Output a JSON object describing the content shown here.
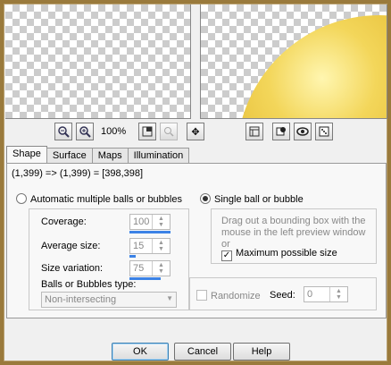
{
  "toolbar": {
    "zoom": "100%",
    "icons": [
      "zoom-out-icon",
      "zoom-in-icon",
      "fit-window-icon",
      "zoom-proof-icon",
      "pan-icon",
      "preview-toggle-icon",
      "randomize-icon",
      "eye-icon",
      "dice-icon"
    ]
  },
  "tabs": [
    {
      "label": "Shape",
      "active": true
    },
    {
      "label": "Surface",
      "active": false
    },
    {
      "label": "Maps",
      "active": false
    },
    {
      "label": "Illumination",
      "active": false
    }
  ],
  "shape": {
    "coords": "(1,399) => (1,399) = [398,398]",
    "auto_option": "Automatic multiple balls or bubbles",
    "single_option": "Single ball or bubble",
    "selected": "single",
    "coverage_label": "Coverage:",
    "coverage_value": "100",
    "coverage_level": 1.0,
    "avg_size_label": "Average size:",
    "avg_size_value": "15",
    "avg_size_level": 0.15,
    "size_var_label": "Size variation:",
    "size_var_value": "75",
    "size_var_level": 0.75,
    "type_label": "Balls or Bubbles type:",
    "type_value": "Non-intersecting",
    "hint": "Drag out a bounding box with the mouse in the left preview window or",
    "max_size_label": "Maximum possible size",
    "max_size_checked": true,
    "randomize_label": "Randomize",
    "seed_label": "Seed:",
    "seed_value": "0"
  },
  "buttons": {
    "ok": "OK",
    "cancel": "Cancel",
    "help": "Help"
  },
  "colors": {
    "accent_bar": "#3c82e6",
    "window_frame": "#9a7a3c",
    "ball": "#e2b72c"
  }
}
